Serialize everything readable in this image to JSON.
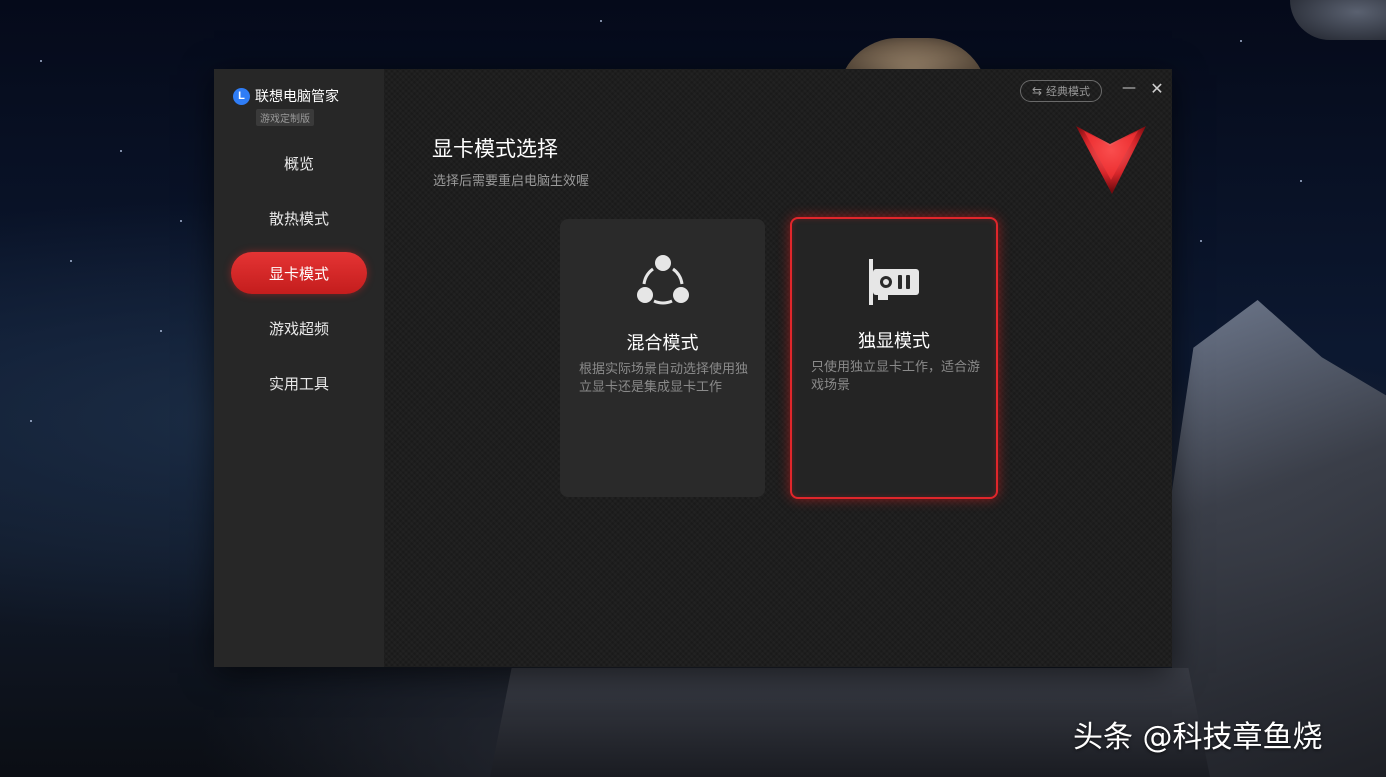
{
  "app": {
    "name": "联想电脑管家",
    "edition_badge": "游戏定制版",
    "classic_mode_label": "经典模式",
    "minimize_glyph": "—",
    "close_glyph": "✕",
    "accent_color": "#e0262b",
    "brand_color": "#2f7df6",
    "brand_logo_letter": "L"
  },
  "sidebar": {
    "items": [
      {
        "label": "概览",
        "active": false
      },
      {
        "label": "散热模式",
        "active": false
      },
      {
        "label": "显卡模式",
        "active": true
      },
      {
        "label": "游戏超频",
        "active": false
      },
      {
        "label": "实用工具",
        "active": false
      }
    ]
  },
  "main": {
    "title": "显卡模式选择",
    "subtitle": "选择后需要重启电脑生效喔",
    "cards": [
      {
        "icon": "hybrid-mode-icon",
        "title": "混合模式",
        "description": "根据实际场景自动选择使用独立显卡还是集成显卡工作",
        "selected": false
      },
      {
        "icon": "graphics-card-icon",
        "title": "独显模式",
        "description": "只使用独立显卡工作，适合游戏场景",
        "selected": true
      }
    ]
  },
  "watermark": "头条 @科技章鱼烧"
}
